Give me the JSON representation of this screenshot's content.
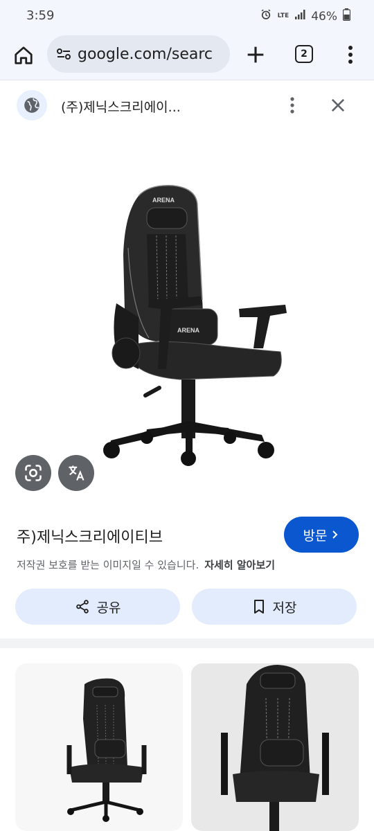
{
  "status_bar": {
    "time": "3:59",
    "network": "LTE",
    "battery": "46%",
    "icons": [
      "alarm-icon",
      "signal-icon",
      "battery-icon"
    ]
  },
  "browser": {
    "url": "google.com/searc",
    "tab_count": "2",
    "icons": [
      "home-icon",
      "site-info-icon",
      "new-tab-icon",
      "overflow-menu-icon"
    ]
  },
  "source": {
    "name": "(주)제닉스크리에이...",
    "icons": [
      "globe-icon",
      "more-vert-icon",
      "close-icon"
    ]
  },
  "image": {
    "brand_label": "ARENA"
  },
  "result": {
    "title": "주)제닉스크리에이티브",
    "visit_label": "방문",
    "copyright_text": "저작권 보호를 받는 이미지일 수 있습니다.",
    "learn_more": "자세히 알아보기",
    "share_label": "공유",
    "save_label": "저장"
  },
  "colors": {
    "accent": "#0b57d0",
    "chip_bg": "#e3ecfd",
    "toolbar_bg": "#f3f6fc"
  }
}
